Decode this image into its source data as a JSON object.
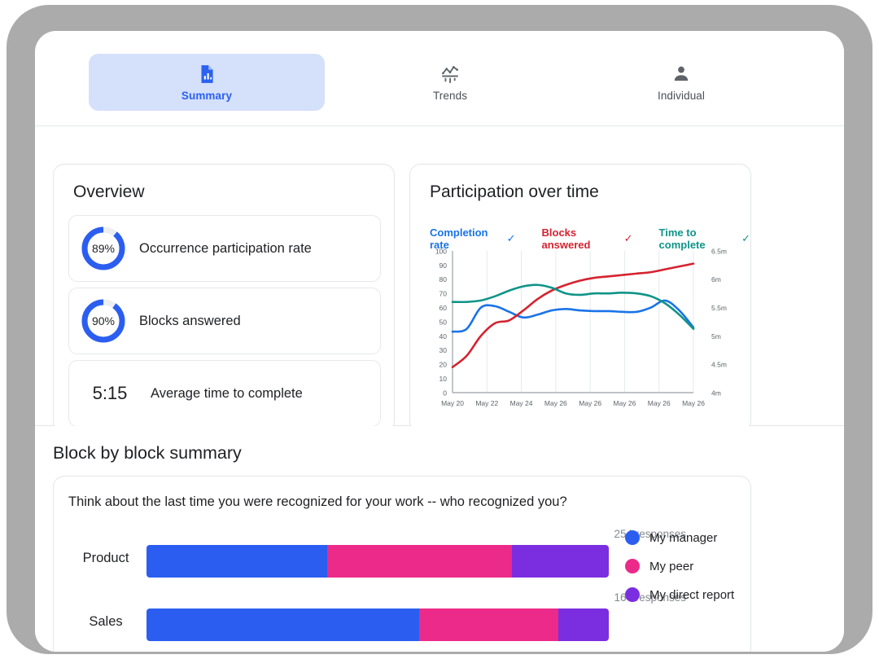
{
  "tabs": [
    {
      "label": "Summary",
      "icon": "document-chart-icon",
      "active": true
    },
    {
      "label": "Trends",
      "icon": "trends-icon",
      "active": false
    },
    {
      "label": "Individual",
      "icon": "person-icon",
      "active": false
    }
  ],
  "overview": {
    "title": "Overview",
    "metrics": [
      {
        "value": "89%",
        "percent": 89,
        "label": "Occurrence participation rate",
        "type": "donut"
      },
      {
        "value": "90%",
        "percent": 90,
        "label": "Blocks answered",
        "type": "donut"
      },
      {
        "value": "5:15",
        "label": "Average time to complete",
        "type": "value"
      }
    ]
  },
  "participation": {
    "title": "Participation over time",
    "legend": [
      {
        "label": "Completion rate",
        "color": "#1a73e8",
        "checked": true,
        "check": "✓"
      },
      {
        "label": "Blocks answered",
        "color": "#d5232f",
        "checked": true,
        "check": "✓"
      },
      {
        "label": "Time to complete",
        "color": "#0f9488",
        "checked": true,
        "check": "✓"
      }
    ]
  },
  "chart_data": {
    "type": "line",
    "title": "Participation over time",
    "xlabel": "",
    "ylabel": "",
    "grid": true,
    "legend_position": "top",
    "x": [
      "May 20",
      "May 22",
      "May 24",
      "May 26",
      "May 26",
      "May 26",
      "May 26",
      "May 26"
    ],
    "xtick_labels": [
      "May 20",
      "May 22",
      "May 24",
      "May 26",
      "May 26",
      "May 26",
      "May 26",
      "May 26"
    ],
    "left_axis": {
      "ylim": [
        0,
        100
      ],
      "ticks": [
        0,
        10,
        20,
        30,
        40,
        50,
        60,
        70,
        80,
        90,
        100
      ]
    },
    "right_axis": {
      "ylim": [
        "4m",
        "6.5m"
      ],
      "ticks": [
        "4m",
        "4.5m",
        "5m",
        "5.5m",
        "6m",
        "6.5m"
      ]
    },
    "series": [
      {
        "name": "Completion rate",
        "color": "#1a73e8",
        "axis": "left",
        "values": [
          43,
          45,
          60,
          61,
          57,
          53,
          55,
          58,
          59,
          58,
          57.5,
          57.5,
          57,
          57,
          60,
          65,
          58,
          46
        ]
      },
      {
        "name": "Blocks answered",
        "color": "#d5232f",
        "axis": "left",
        "values": [
          18,
          26,
          40,
          49,
          51,
          58,
          66,
          72,
          76,
          79,
          81,
          82,
          83,
          84,
          85,
          87,
          89,
          91
        ]
      },
      {
        "name": "Time to complete",
        "color": "#0f9488",
        "axis": "left",
        "values": [
          64,
          64,
          65,
          68,
          72,
          75,
          76,
          74,
          70,
          69,
          70,
          70,
          70.5,
          70,
          68,
          63,
          55,
          45
        ]
      }
    ]
  },
  "block_summary": {
    "title": "Block by block summary",
    "question": "Think about the last time you were recognized for your work -- who recognized you?",
    "legend": [
      {
        "label": "My manager",
        "color": "#2b5ef0"
      },
      {
        "label": "My peer",
        "color": "#ec2a89"
      },
      {
        "label": "My direct report",
        "color": "#7b2ee0"
      }
    ],
    "bars": [
      {
        "category": "Product",
        "responses": "254 responses",
        "segments": [
          {
            "name": "My manager",
            "percent": 39,
            "color": "#2b5ef0"
          },
          {
            "name": "My peer",
            "percent": 40,
            "color": "#ec2a89"
          },
          {
            "name": "My direct report",
            "percent": 21,
            "color": "#7b2ee0"
          }
        ]
      },
      {
        "category": "Sales",
        "responses": "164 responses",
        "segments": [
          {
            "name": "My manager",
            "percent": 59,
            "color": "#2b5ef0"
          },
          {
            "name": "My peer",
            "percent": 30,
            "color": "#ec2a89"
          },
          {
            "name": "My direct report",
            "percent": 11,
            "color": "#7b2ee0"
          }
        ]
      }
    ]
  },
  "colors": {
    "accent_blue": "#2b61f0",
    "tab_active_bg": "#d5e0fb",
    "donut_blue": "#2b5ef0",
    "donut_track": "#eceef1",
    "frame_gray": "#ababab"
  }
}
